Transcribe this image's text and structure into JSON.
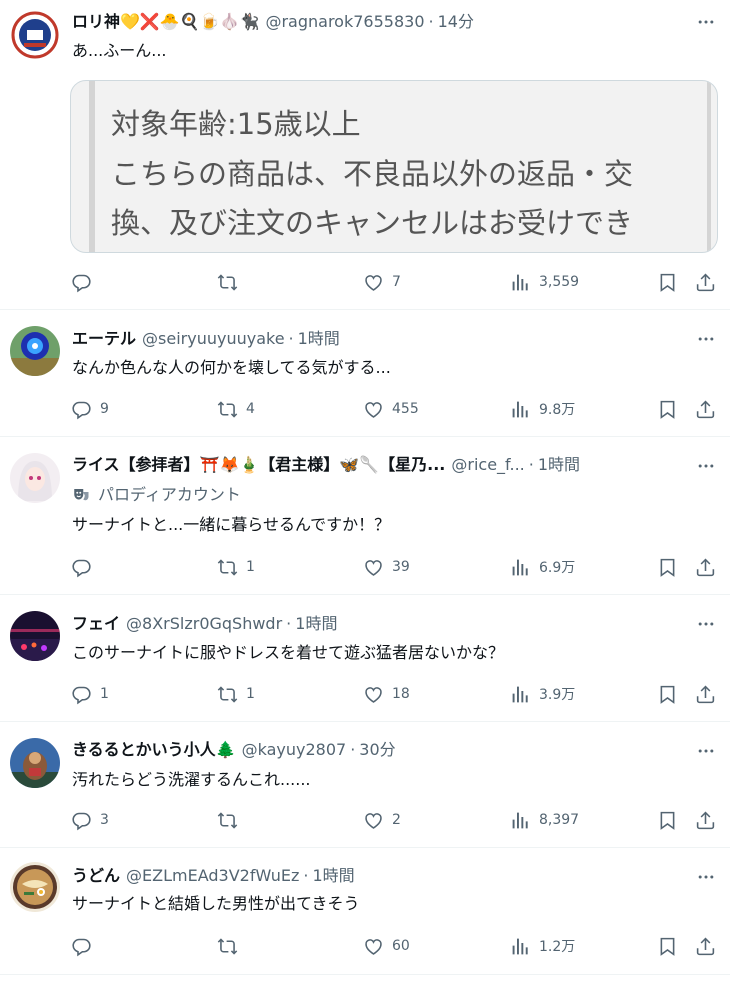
{
  "colors": {
    "text": "#0f1419",
    "muted": "#536471",
    "border": "#eff3f4"
  },
  "posts": [
    {
      "name": "ロリ神💛❌🐣🍳🍺🧄🐈‍⬛",
      "handle": "@ragnarok7655830",
      "sep": "·",
      "time": "14分",
      "text": "あ...ふーん...",
      "embed": [
        "対象年齢:15歳以上",
        "こちらの商品は、不良品以外の返品・交",
        "換、及び注文のキャンセルはお受けでき"
      ],
      "reply": "",
      "retweet": "",
      "like": "7",
      "views": "3,559"
    },
    {
      "name": "エーテル",
      "handle": "@seiryuuyuuyake",
      "sep": "·",
      "time": "1時間",
      "text": "なんか色んな人の何かを壊してる気がする...",
      "reply": "9",
      "retweet": "4",
      "like": "455",
      "views": "9.8万"
    },
    {
      "name": "ライス【参拝者】⛩️🦊🎍【君主様】🦋🥄【星乃...",
      "handle": "@rice_f...",
      "sep": "·",
      "time": "1時間",
      "label": "パロディアカウント",
      "text": "サーナイトと...一緒に暮らせるんですか！？",
      "reply": "",
      "retweet": "1",
      "like": "39",
      "views": "6.9万"
    },
    {
      "name": "フェイ",
      "handle": "@8XrSlzr0GqShwdr",
      "sep": "·",
      "time": "1時間",
      "text": "このサーナイトに服やドレスを着せて遊ぶ猛者居ないかな？",
      "reply": "1",
      "retweet": "1",
      "like": "18",
      "views": "3.9万"
    },
    {
      "name": "きるるとかいう小人🌲",
      "handle": "@kayuy2807",
      "sep": "·",
      "time": "30分",
      "text": "汚れたらどう洗濯するんこれ......",
      "reply": "3",
      "retweet": "",
      "like": "2",
      "views": "8,397"
    },
    {
      "name": "うどん",
      "handle": "@EZLmEAd3V2fWuEz",
      "sep": "·",
      "time": "1時間",
      "text": "サーナイトと結婚した男性が出てきそう",
      "reply": "",
      "retweet": "",
      "like": "60",
      "views": "1.2万"
    }
  ]
}
